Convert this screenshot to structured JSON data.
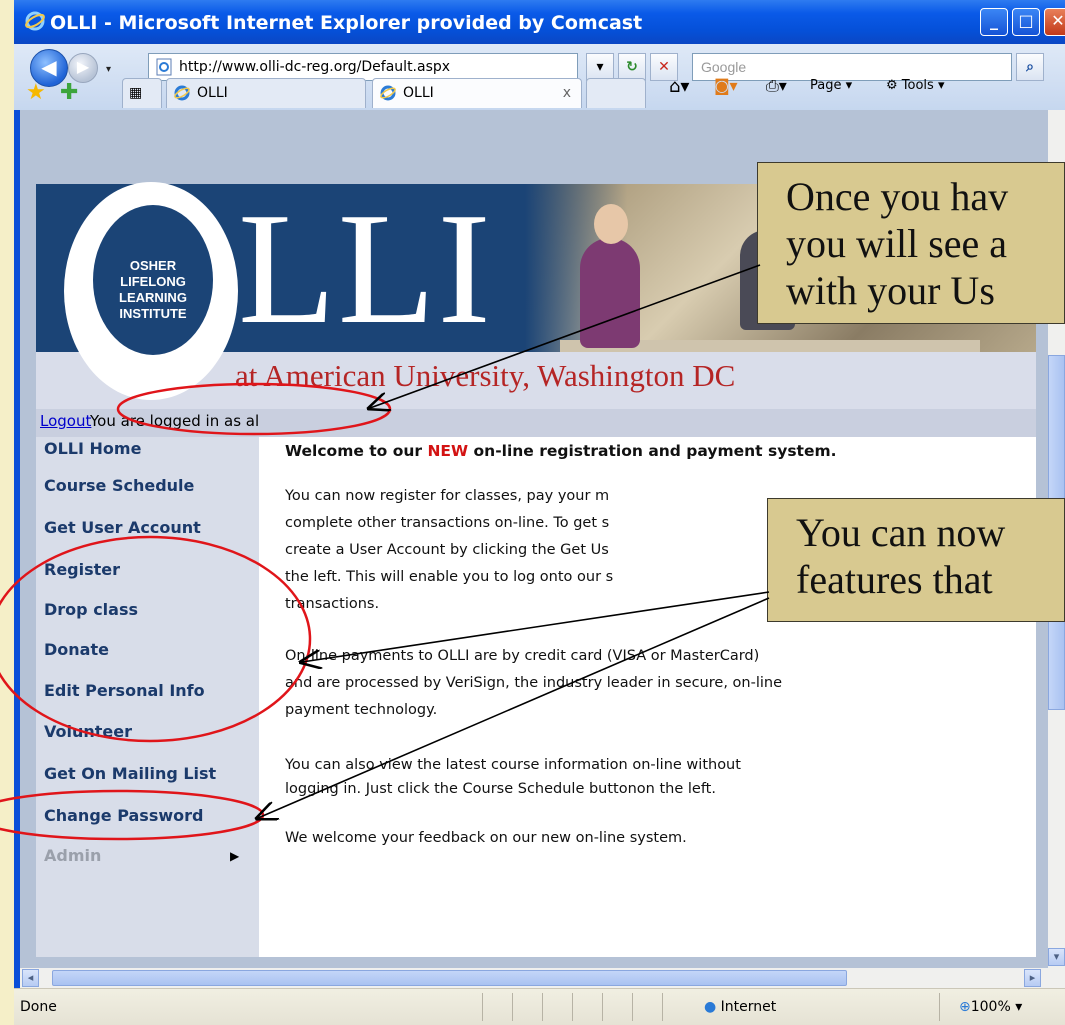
{
  "window": {
    "title": "OLLI - Microsoft Internet Explorer provided by Comcast",
    "minimize_label": "_",
    "maximize_label": "□",
    "close_label": "✕"
  },
  "toolbar": {
    "back_icon": "◀",
    "forward_icon": "▶",
    "url": "http://www.olli-dc-reg.org/Default.aspx",
    "search_placeholder": "Google",
    "refresh_icon": "↻",
    "stop_icon": "✕",
    "dropdown_icon": "▾",
    "search_icon": "⌕"
  },
  "tabs": [
    {
      "label": "OLLI"
    },
    {
      "label": "OLLI",
      "close": "x"
    }
  ],
  "command_bar": {
    "page_label": "Page",
    "tools_label": "Tools"
  },
  "banner": {
    "osher_lines": [
      "OSHER",
      "LIFELONG",
      "LEARNING",
      "INSTITUTE"
    ],
    "logo_text": "LLI",
    "tagline": "at American University, Washington DC"
  },
  "login": {
    "logout_label": "Logout",
    "status_text": "You are logged in as al"
  },
  "sidebar": {
    "items": [
      {
        "label": "OLLI Home"
      },
      {
        "label": "Course Schedule"
      },
      {
        "label": "Get User Account"
      },
      {
        "label": "Register"
      },
      {
        "label": "Drop class"
      },
      {
        "label": "Donate"
      },
      {
        "label": "Edit Personal Info"
      },
      {
        "label": "Volunteer"
      },
      {
        "label": "Get On Mailing List"
      },
      {
        "label": "Change Password"
      },
      {
        "label": "Admin"
      }
    ],
    "admin_arrow": "▶"
  },
  "content": {
    "welcome_prefix": "Welcome to our ",
    "welcome_new": "NEW",
    "welcome_suffix": " on-line registration and payment system.",
    "para1": [
      "You can now register for classes, pay your m",
      "complete other transactions on-line. To get s",
      "create a User Account by clicking the Get Us",
      "the left. This will enable you to log onto our s",
      "transactions."
    ],
    "para2": [
      "On-line payments to OLLI are by credit card (VISA or MasterCard)",
      "and are processed by VeriSign, the industry leader in secure, on-line",
      "payment technology."
    ],
    "para3": [
      "You can also view the latest course information on-line without",
      "logging in. Just click the Course Schedule buttonon the left."
    ],
    "para4": "We welcome your feedback on our new on-line system."
  },
  "status_bar": {
    "status": "Done",
    "zone": "Internet",
    "zoom": "100%"
  },
  "callouts": [
    {
      "lines": [
        "Once you hav",
        "you will see a",
        "with your Us"
      ]
    },
    {
      "lines": [
        "You can now",
        "features that"
      ]
    }
  ]
}
